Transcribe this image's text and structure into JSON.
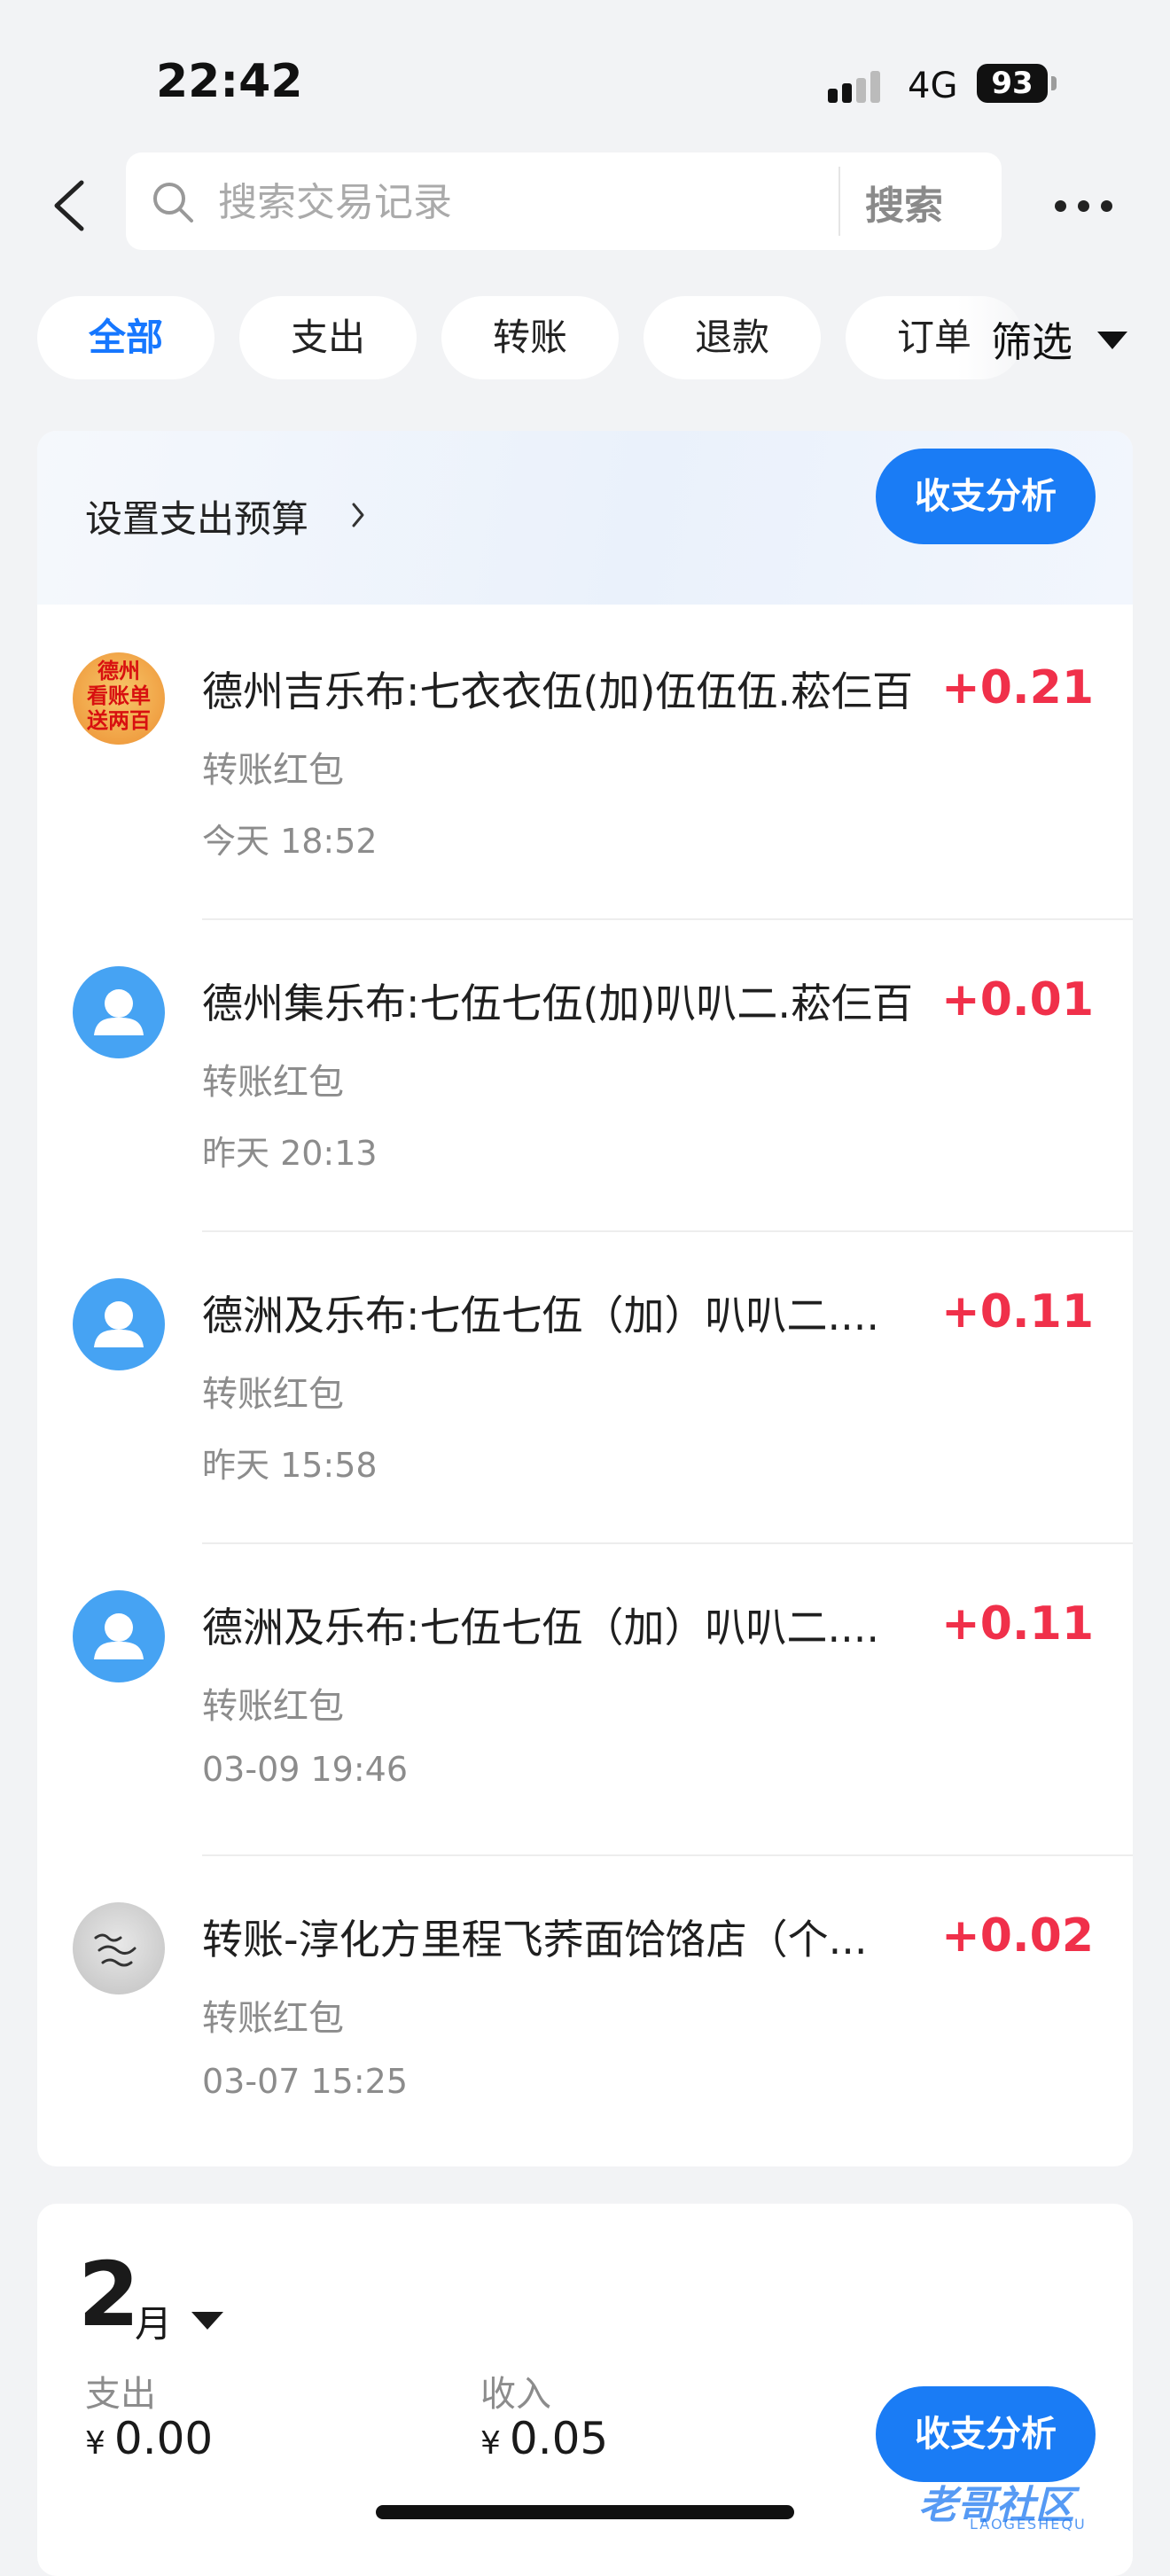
{
  "status_bar": {
    "time": "22:42",
    "network": "4G",
    "battery": "93"
  },
  "header": {
    "search_placeholder": "搜索交易记录",
    "search_button": "搜索",
    "more_icon": "more-dots-icon",
    "back_icon": "chevron-left-icon"
  },
  "tabs": [
    {
      "label": "全部",
      "active": true
    },
    {
      "label": "支出",
      "active": false
    },
    {
      "label": "转账",
      "active": false
    },
    {
      "label": "退款",
      "active": false
    },
    {
      "label": "订单",
      "active": false
    }
  ],
  "filter": {
    "label": "筛选"
  },
  "budget": {
    "link_label": "设置支出预算",
    "analysis_button": "收支分析"
  },
  "transactions": [
    {
      "title": "德州吉乐布:七衣衣伍(加)伍伍伍.菘仨百",
      "category": "转账红包",
      "time": "今天 18:52",
      "amount": "+0.21",
      "avatar": "promo",
      "avatar_text": [
        "德州",
        "看账单",
        "送两百"
      ]
    },
    {
      "title": "德州集乐布:七伍七伍(加)叭叭二.菘仨百",
      "category": "转账红包",
      "time": "昨天 20:13",
      "amount": "+0.01",
      "avatar": "default-user"
    },
    {
      "title": "德洲及乐布:七伍七伍（加）叭叭二....",
      "category": "转账红包",
      "time": "昨天 15:58",
      "amount": "+0.11",
      "avatar": "default-user"
    },
    {
      "title": "德洲及乐布:七伍七伍（加）叭叭二....",
      "category": "转账红包",
      "time": "03-09 19:46",
      "amount": "+0.11",
      "avatar": "default-user"
    },
    {
      "title": "转账-淳化方里程飞荞面饸饹店（个...",
      "category": "转账红包",
      "time": "03-07 15:25",
      "amount": "+0.02",
      "avatar": "handwritten"
    }
  ],
  "month_summary": {
    "month": "2",
    "month_unit": "月",
    "expense_label": "支出",
    "expense_currency": "¥",
    "expense_value": "0.00",
    "income_label": "收入",
    "income_currency": "¥",
    "income_value": "0.05",
    "analysis_button": "收支分析"
  },
  "watermark": {
    "text": "老哥社区",
    "sub": "LAOGESHEQU"
  },
  "colors": {
    "accent": "#1a7cf5",
    "amount": "#f0304a",
    "background": "#f2f3f5"
  }
}
